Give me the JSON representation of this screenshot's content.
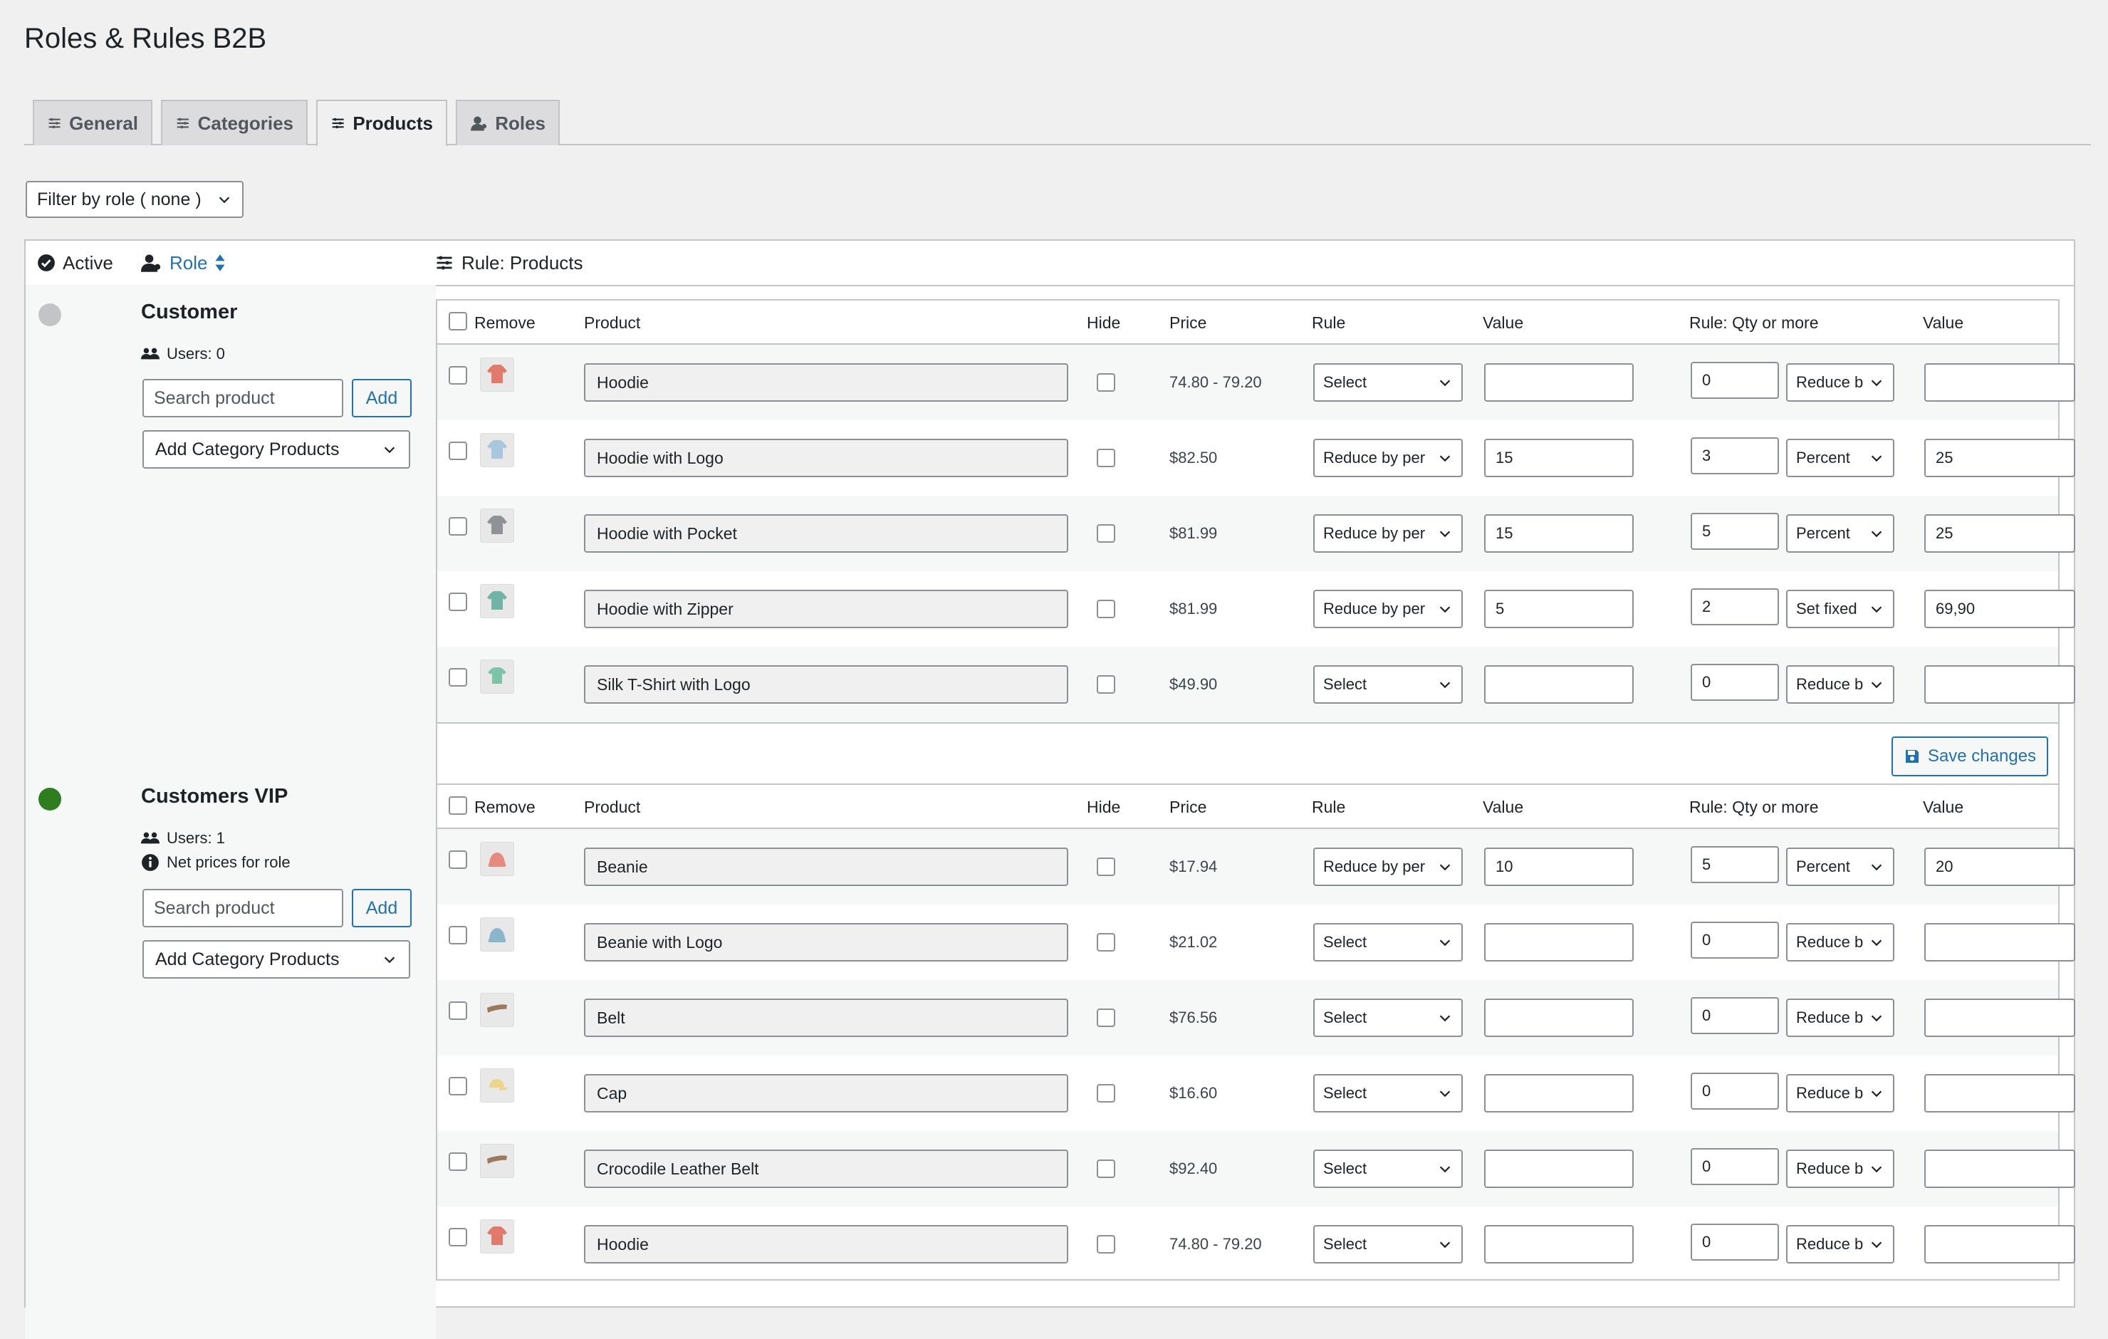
{
  "page_title": "Roles & Rules B2B",
  "tabs": [
    {
      "label": "General",
      "active": false
    },
    {
      "label": "Categories",
      "active": false
    },
    {
      "label": "Products",
      "active": true
    },
    {
      "label": "Roles",
      "active": false
    }
  ],
  "filter": {
    "label": "Filter by role ( none )"
  },
  "header": {
    "active": "Active",
    "role": "Role",
    "rule": "Rule: Products"
  },
  "columns": {
    "remove": "Remove",
    "product": "Product",
    "hide": "Hide",
    "price": "Price",
    "rule": "Rule",
    "value": "Value",
    "rule_qty": "Rule: Qty or more",
    "value2": "Value"
  },
  "search_placeholder": "Search product",
  "add_label": "Add",
  "category_select": "Add Category Products",
  "save_label": "Save changes",
  "colors": {
    "inactive_dot": "#c3c4c7",
    "active_dot": "#2e7d1e",
    "accent": "#2271b1"
  },
  "roles": [
    {
      "name": "Customer",
      "users": "Users: 0",
      "net_prices": "",
      "active": false,
      "products": [
        {
          "name": "Hoodie",
          "price": "74.80 - 79.20",
          "rule": "Select",
          "value": "",
          "qty": "0",
          "qty_rule": "Reduce b",
          "value2": "",
          "thumb": "hoodie-red"
        },
        {
          "name": "Hoodie with Logo",
          "price": "$82.50",
          "rule": "Reduce by per",
          "value": "15",
          "qty": "3",
          "qty_rule": "Percent",
          "value2": "25",
          "thumb": "hoodie-blue"
        },
        {
          "name": "Hoodie with Pocket",
          "price": "$81.99",
          "rule": "Reduce by per",
          "value": "15",
          "qty": "5",
          "qty_rule": "Percent",
          "value2": "25",
          "thumb": "hoodie-gray"
        },
        {
          "name": "Hoodie with Zipper",
          "price": "$81.99",
          "rule": "Reduce by per",
          "value": "5",
          "qty": "2",
          "qty_rule": "Set fixed",
          "value2": "69,90",
          "thumb": "hoodie-teal"
        },
        {
          "name": "Silk T-Shirt with Logo",
          "price": "$49.90",
          "rule": "Select",
          "value": "",
          "qty": "0",
          "qty_rule": "Reduce b",
          "value2": "",
          "thumb": "tshirt-green"
        }
      ]
    },
    {
      "name": "Customers VIP",
      "users": "Users: 1",
      "net_prices": "Net prices for role",
      "active": true,
      "products": [
        {
          "name": "Beanie",
          "price": "$17.94",
          "rule": "Reduce by per",
          "value": "10",
          "qty": "5",
          "qty_rule": "Percent",
          "value2": "20",
          "thumb": "beanie-red"
        },
        {
          "name": "Beanie with Logo",
          "price": "$21.02",
          "rule": "Select",
          "value": "",
          "qty": "0",
          "qty_rule": "Reduce b",
          "value2": "",
          "thumb": "beanie-blue"
        },
        {
          "name": "Belt",
          "price": "$76.56",
          "rule": "Select",
          "value": "",
          "qty": "0",
          "qty_rule": "Reduce b",
          "value2": "",
          "thumb": "belt-brown"
        },
        {
          "name": "Cap",
          "price": "$16.60",
          "rule": "Select",
          "value": "",
          "qty": "0",
          "qty_rule": "Reduce b",
          "value2": "",
          "thumb": "cap-yellow"
        },
        {
          "name": "Crocodile Leather Belt",
          "price": "$92.40",
          "rule": "Select",
          "value": "",
          "qty": "0",
          "qty_rule": "Reduce b",
          "value2": "",
          "thumb": "belt-brown"
        },
        {
          "name": "Hoodie",
          "price": "74.80 - 79.20",
          "rule": "Select",
          "value": "",
          "qty": "0",
          "qty_rule": "Reduce b",
          "value2": "",
          "thumb": "hoodie-red"
        }
      ]
    }
  ]
}
